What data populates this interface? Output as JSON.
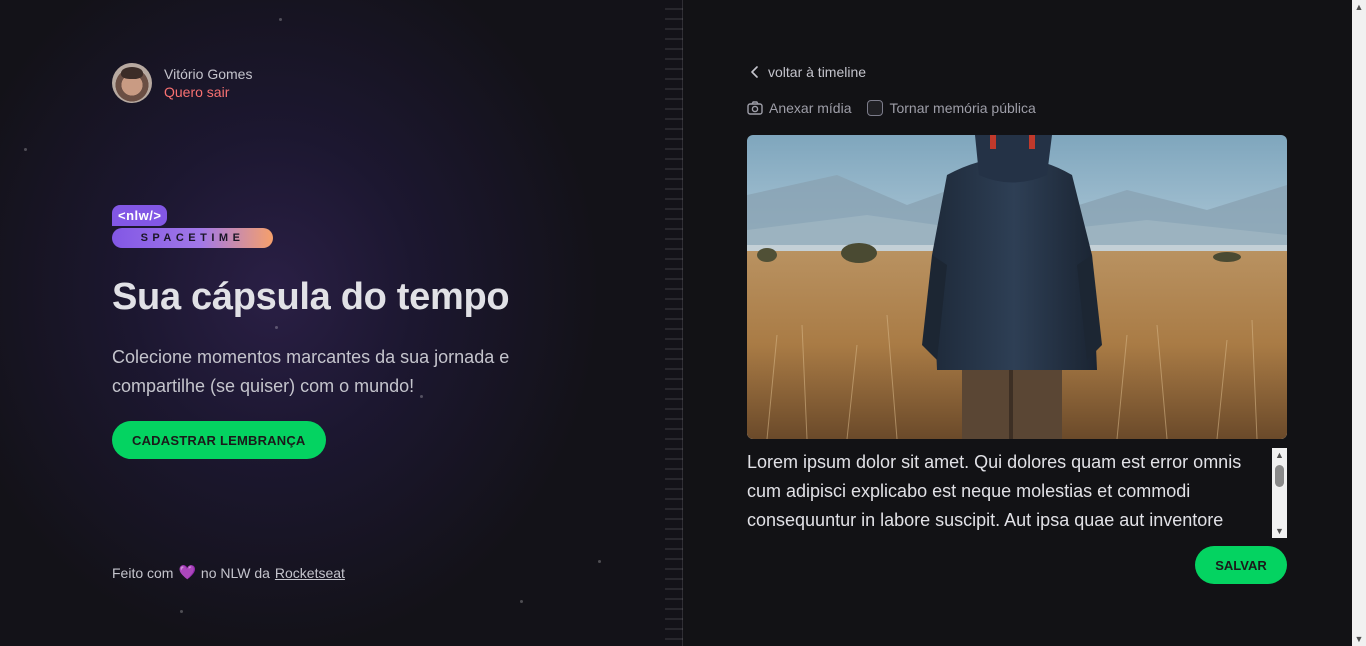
{
  "user": {
    "name": "Vitório Gomes",
    "logout_label": "Quero sair"
  },
  "brand": {
    "top_label": "<nlw/>",
    "bottom_label": "SPACETIME"
  },
  "hero": {
    "title": "Sua cápsula do tempo",
    "description": "Colecione momentos marcantes da sua jornada e compartilhe (se quiser) com o mundo!",
    "cta_label": "CADASTRAR LEMBRANÇA"
  },
  "footer": {
    "prefix": "Feito com",
    "middle": "no NLW da",
    "link_label": "Rocketseat",
    "heart": "💜"
  },
  "editor": {
    "back_label": "voltar à timeline",
    "attach_label": "Anexar mídia",
    "public_label": "Tornar memória pública",
    "public_checked": false,
    "content": "Lorem ipsum dolor sit amet. Qui dolores quam est error omnis cum adipisci explicabo est neque molestias et commodi consequuntur in labore suscipit. Aut ipsa quae aut inventore",
    "save_label": "SALVAR"
  },
  "colors": {
    "accent_green": "#04d361",
    "accent_purple": "#8257e5",
    "logout_red": "#f87171"
  },
  "icons": {
    "back": "chevron-left-icon",
    "attach": "camera-icon",
    "heart": "heart-icon"
  }
}
